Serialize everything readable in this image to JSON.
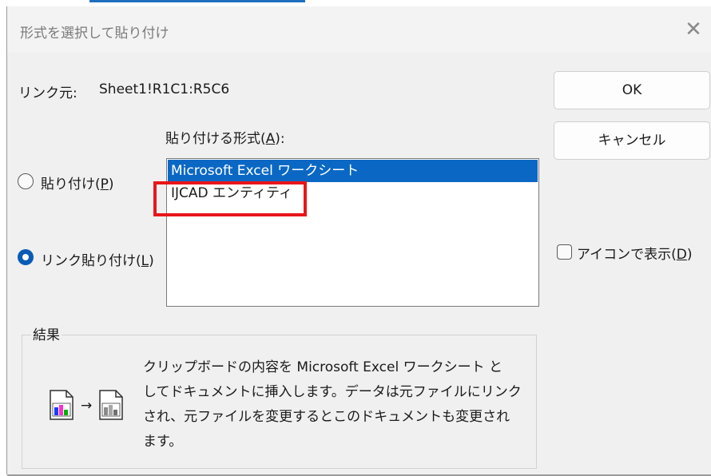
{
  "dialog": {
    "title": "形式を選択して貼り付け",
    "close_glyph": "✕"
  },
  "source": {
    "label": "リンク元:",
    "value": "Sheet1!R1C1:R5C6"
  },
  "format_list": {
    "label_prefix": "貼り付ける形式(",
    "label_access": "A",
    "label_suffix": "):",
    "items": [
      {
        "label": "Microsoft Excel ワークシート",
        "selected": true
      },
      {
        "label": "IJCAD エンティティ",
        "selected": false
      }
    ]
  },
  "paste_options": {
    "paste": {
      "prefix": "貼り付け(",
      "access": "P",
      "suffix": ")",
      "checked": false
    },
    "paste_link": {
      "prefix": "リンク貼り付け(",
      "access": "L",
      "suffix": ")",
      "checked": true
    }
  },
  "buttons": {
    "ok": "OK",
    "cancel": "キャンセル"
  },
  "display_as_icon": {
    "prefix": "アイコンで表示(",
    "access": "D",
    "suffix": ")",
    "checked": false
  },
  "result": {
    "label": "結果",
    "lines": [
      "クリップボードの内容を Microsoft Excel ワークシート と",
      "してドキュメントに挿入します。データは元ファイルにリンク",
      "され、元ファイルを変更するとこのドキュメントも変更され",
      "ます。"
    ],
    "arrow_glyph": "→"
  },
  "colors": {
    "selection": "#0a68c4",
    "radio_checked": "#0a5bb5",
    "highlight_border": "#e8161a"
  },
  "icons": [
    "close-icon",
    "radio-icon",
    "checkbox-icon",
    "document-chart-icon",
    "arrow-right-icon"
  ]
}
